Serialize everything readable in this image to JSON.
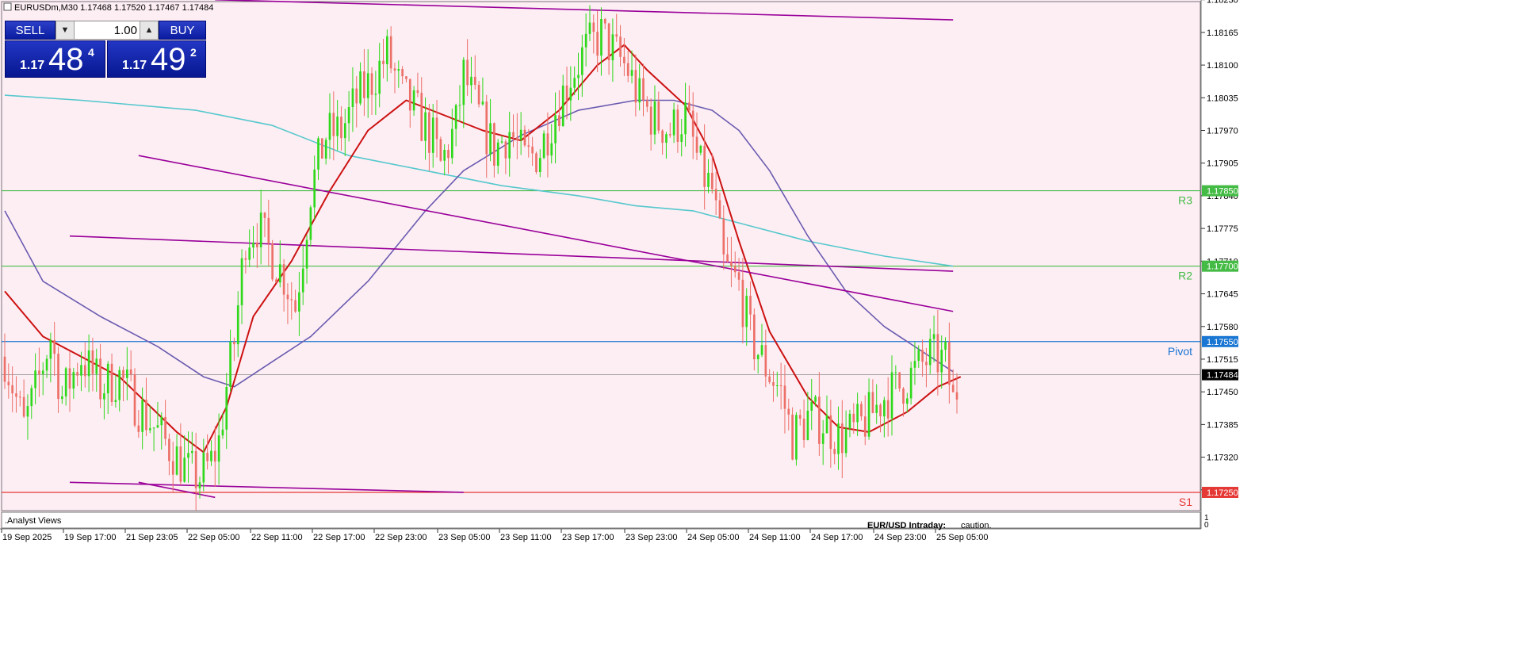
{
  "header": {
    "symbol_info": "EURUSDm,M30  1.17468 1.17520 1.17467 1.17484"
  },
  "trade_panel": {
    "sell_label": "SELL",
    "buy_label": "BUY",
    "lot_value": "1.00",
    "sell_price": {
      "small": "1.17",
      "big": "48",
      "sup": "4"
    },
    "buy_price": {
      "small": "1.17",
      "big": "49",
      "sup": "2"
    }
  },
  "colors": {
    "background": "#fdeef4",
    "bull_candle": "#2fd81a",
    "bear_candle": "#ec7068",
    "ema_fast": "#cc1111",
    "ma_mid": "#6a5bb0",
    "ma_slow": "#55c8cc",
    "trendline": "#990099",
    "resistance": "#44bb44",
    "pivot": "#1976d2",
    "support": "#e53935"
  },
  "bottom_panel": {
    "title": ".Analyst Views",
    "headline": "EUR/USD Intraday:",
    "comment": "caution.",
    "scale_top": "1",
    "scale_bottom": "0"
  },
  "chart_data": {
    "type": "candlestick",
    "timeframe": "M30",
    "ylim": [
      1.1722,
      1.1822
    ],
    "y_ticks": [
      "1.18230",
      "1.18165",
      "1.18100",
      "1.18035",
      "1.17970",
      "1.17905",
      "1.17840",
      "1.17775",
      "1.17710",
      "1.17645",
      "1.17580",
      "1.17515",
      "1.17450",
      "1.17385",
      "1.17320",
      "1.17255"
    ],
    "x_tick_labels": [
      "19 Sep 2025",
      "19 Sep 17:00",
      "21 Sep 23:05",
      "22 Sep 05:00",
      "22 Sep 11:00",
      "22 Sep 17:00",
      "22 Sep 23:00",
      "23 Sep 05:00",
      "23 Sep 11:00",
      "23 Sep 17:00",
      "23 Sep 23:00",
      "24 Sep 05:00",
      "24 Sep 11:00",
      "24 Sep 17:00",
      "24 Sep 23:00",
      "25 Sep 05:00"
    ],
    "current_price": "1.17484",
    "levels": [
      {
        "name": "R3",
        "value": 1.1785,
        "label": "1.17850"
      },
      {
        "name": "R2",
        "value": 1.177,
        "label": "1.17700"
      },
      {
        "name": "Pivot",
        "value": 1.1755,
        "label": "1.17550"
      },
      {
        "name": "S1",
        "value": 1.1725,
        "label": "1.17250"
      }
    ],
    "price_path": [
      [
        0,
        1.1752
      ],
      [
        5,
        1.1738
      ],
      [
        8,
        1.1745
      ],
      [
        12,
        1.1756
      ],
      [
        15,
        1.1744
      ],
      [
        20,
        1.1752
      ],
      [
        25,
        1.1746
      ],
      [
        30,
        1.1748
      ],
      [
        35,
        1.1742
      ],
      [
        40,
        1.1737
      ],
      [
        44,
        1.1733
      ],
      [
        48,
        1.1729
      ],
      [
        51,
        1.1728
      ],
      [
        54,
        1.1731
      ],
      [
        56,
        1.1735
      ],
      [
        58,
        1.1746
      ],
      [
        60,
        1.1755
      ],
      [
        63,
        1.1776
      ],
      [
        66,
        1.1778
      ],
      [
        70,
        1.1772
      ],
      [
        73,
        1.1768
      ],
      [
        76,
        1.1762
      ],
      [
        78,
        1.1773
      ],
      [
        80,
        1.1785
      ],
      [
        84,
        1.1796
      ],
      [
        88,
        1.1797
      ],
      [
        92,
        1.1803
      ],
      [
        96,
        1.1807
      ],
      [
        100,
        1.1812
      ],
      [
        104,
        1.1804
      ],
      [
        108,
        1.18
      ],
      [
        112,
        1.1795
      ],
      [
        114,
        1.179
      ],
      [
        118,
        1.1798
      ],
      [
        120,
        1.1808
      ],
      [
        124,
        1.18
      ],
      [
        128,
        1.1793
      ],
      [
        132,
        1.1797
      ],
      [
        136,
        1.1791
      ],
      [
        140,
        1.1793
      ],
      [
        144,
        1.1801
      ],
      [
        148,
        1.1808
      ],
      [
        152,
        1.1813
      ],
      [
        156,
        1.1816
      ],
      [
        160,
        1.1812
      ],
      [
        163,
        1.1809
      ],
      [
        166,
        1.1803
      ],
      [
        170,
        1.1799
      ],
      [
        174,
        1.1797
      ],
      [
        178,
        1.18
      ],
      [
        182,
        1.1789
      ],
      [
        185,
        1.1785
      ],
      [
        188,
        1.177
      ],
      [
        192,
        1.1766
      ],
      [
        195,
        1.1756
      ],
      [
        199,
        1.175
      ],
      [
        203,
        1.1745
      ],
      [
        206,
        1.1736
      ],
      [
        210,
        1.174
      ],
      [
        214,
        1.1739
      ],
      [
        218,
        1.1736
      ],
      [
        222,
        1.1737
      ],
      [
        226,
        1.174
      ],
      [
        230,
        1.1744
      ],
      [
        234,
        1.1746
      ],
      [
        238,
        1.1749
      ],
      [
        242,
        1.1752
      ],
      [
        246,
        1.1751
      ],
      [
        248,
        1.1743
      ],
      [
        250,
        1.1748
      ]
    ],
    "ema_fast": [
      [
        0,
        1.1765
      ],
      [
        10,
        1.1756
      ],
      [
        30,
        1.1748
      ],
      [
        45,
        1.1737
      ],
      [
        52,
        1.1733
      ],
      [
        58,
        1.1742
      ],
      [
        65,
        1.176
      ],
      [
        75,
        1.1771
      ],
      [
        85,
        1.1785
      ],
      [
        95,
        1.1797
      ],
      [
        105,
        1.1803
      ],
      [
        115,
        1.18
      ],
      [
        125,
        1.1797
      ],
      [
        135,
        1.1795
      ],
      [
        145,
        1.1801
      ],
      [
        155,
        1.181
      ],
      [
        162,
        1.1814
      ],
      [
        168,
        1.1809
      ],
      [
        178,
        1.1802
      ],
      [
        185,
        1.1792
      ],
      [
        192,
        1.1775
      ],
      [
        200,
        1.1757
      ],
      [
        210,
        1.1744
      ],
      [
        218,
        1.1738
      ],
      [
        226,
        1.1737
      ],
      [
        236,
        1.1741
      ],
      [
        244,
        1.1746
      ],
      [
        250,
        1.1748
      ]
    ],
    "ma_mid": [
      [
        0,
        1.1781
      ],
      [
        10,
        1.1767
      ],
      [
        25,
        1.176
      ],
      [
        40,
        1.1754
      ],
      [
        52,
        1.1748
      ],
      [
        60,
        1.1746
      ],
      [
        70,
        1.1751
      ],
      [
        80,
        1.1756
      ],
      [
        95,
        1.1767
      ],
      [
        110,
        1.1781
      ],
      [
        120,
        1.1789
      ],
      [
        135,
        1.1796
      ],
      [
        150,
        1.1801
      ],
      [
        165,
        1.1803
      ],
      [
        175,
        1.1803
      ],
      [
        185,
        1.1801
      ],
      [
        192,
        1.1797
      ],
      [
        200,
        1.1789
      ],
      [
        210,
        1.1776
      ],
      [
        220,
        1.1765
      ],
      [
        230,
        1.1758
      ],
      [
        240,
        1.1753
      ],
      [
        248,
        1.1749
      ]
    ],
    "ma_slow": [
      [
        0,
        1.1804
      ],
      [
        20,
        1.1803
      ],
      [
        50,
        1.1801
      ],
      [
        70,
        1.1798
      ],
      [
        90,
        1.1792
      ],
      [
        110,
        1.1789
      ],
      [
        130,
        1.1786
      ],
      [
        150,
        1.1784
      ],
      [
        165,
        1.1782
      ],
      [
        180,
        1.1781
      ],
      [
        195,
        1.1778
      ],
      [
        210,
        1.1775
      ],
      [
        230,
        1.1772
      ],
      [
        248,
        1.177
      ]
    ],
    "trendlines": [
      [
        [
          55,
          1.1823
        ],
        [
          248,
          1.1819
        ]
      ],
      [
        [
          35,
          1.1792
        ],
        [
          248,
          1.1761
        ]
      ],
      [
        [
          17,
          1.1776
        ],
        [
          248,
          1.1769
        ]
      ],
      [
        [
          17,
          1.1727
        ],
        [
          120,
          1.1725
        ]
      ],
      [
        [
          35,
          1.1727
        ],
        [
          55,
          1.1724
        ]
      ]
    ],
    "n_bars": 250
  }
}
